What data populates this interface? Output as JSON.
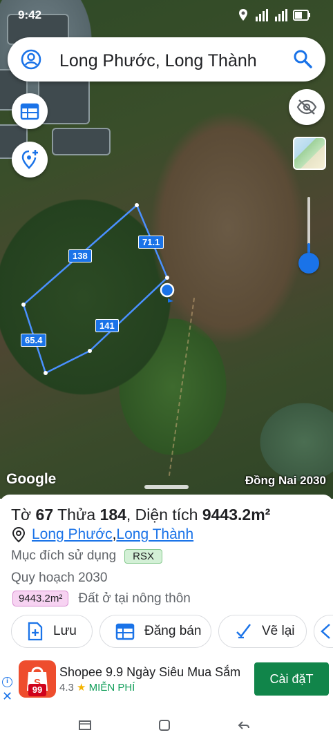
{
  "status": {
    "time": "9:42"
  },
  "search": {
    "query": "Long Phước, Long Thành"
  },
  "map": {
    "edges": [
      "138",
      "71.1",
      "65.4",
      "141"
    ],
    "provider": "Google",
    "plan_layer": "Đồng Nai 2030"
  },
  "parcel": {
    "sheet_prefix": "Tờ ",
    "sheet_no": "67",
    "lot_prefix": " Thửa ",
    "lot_no": "184",
    "area_prefix": ", Diện tích ",
    "area_value": "9443.2m²",
    "ward": "Long Phước",
    "separator": ", ",
    "district": "Long Thành",
    "purpose_label": "Mục đích sử dụng",
    "purpose_code": "RSX",
    "plan_label": "Quy hoạch 2030",
    "plan_area": "9443.2m²",
    "plan_use": "Đất ở tại nông thôn"
  },
  "actions": {
    "save": "Lưu",
    "post_sale": "Đăng bán",
    "redraw": "Vẽ lại"
  },
  "ad": {
    "title": "Shopee 9.9 Ngày Siêu Mua Sắm",
    "rating": "4.3",
    "price": "MIỄN PHÍ",
    "install": "Cài đặT",
    "logo_text": "99"
  },
  "colors": {
    "accent": "#1a73e8",
    "install_green": "#11854a",
    "shopee_orange": "#ee4d2d"
  }
}
